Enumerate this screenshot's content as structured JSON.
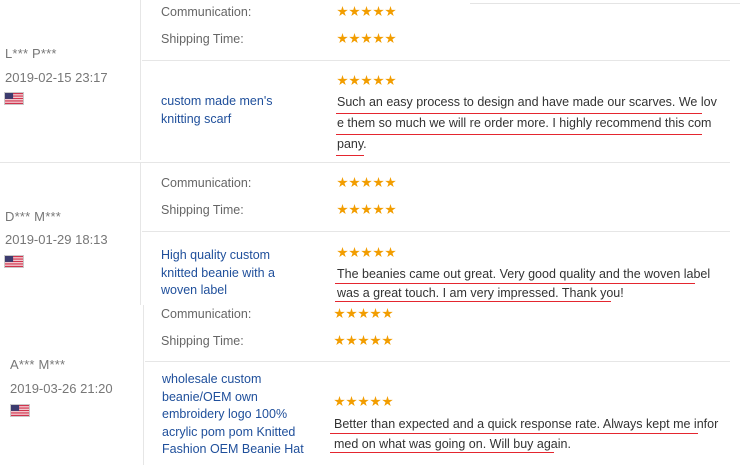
{
  "rating_labels": {
    "communication": "Communication:",
    "shipping_time": "Shipping Time:"
  },
  "stars_per_rating": 5,
  "colors": {
    "star": "#f29d00",
    "link": "#1f4f9b",
    "underline_annotation": "#e4262f"
  },
  "reviews": [
    {
      "user": "L*** P***",
      "date": "2019-02-15 23:17",
      "flag_icon": "us-flag-icon",
      "product": "custom made men's knitting scarf",
      "text_lines": [
        "Such an easy process to design and have made our scarves. We lov",
        "e them so much we will re order more. I highly recommend this com",
        "pany."
      ]
    },
    {
      "user": "D*** M***",
      "date": "2019-01-29 18:13",
      "flag_icon": "us-flag-icon",
      "product": "High quality custom knitted beanie with a woven label",
      "text_lines": [
        "The beanies came out great. Very good quality and the woven label",
        "was a great touch. I am very impressed. Thank you!"
      ]
    },
    {
      "user": "A*** M***",
      "date": "2019-03-26 21:20",
      "flag_icon": "us-flag-icon",
      "product": "wholesale custom beanie/OEM own embroidery logo 100% acrylic pom pom Knitted Fashion OEM Beanie Hat",
      "text_lines": [
        "Better than expected and a quick response rate. Always kept me infor",
        "med on what was going on. Will buy again."
      ]
    }
  ]
}
